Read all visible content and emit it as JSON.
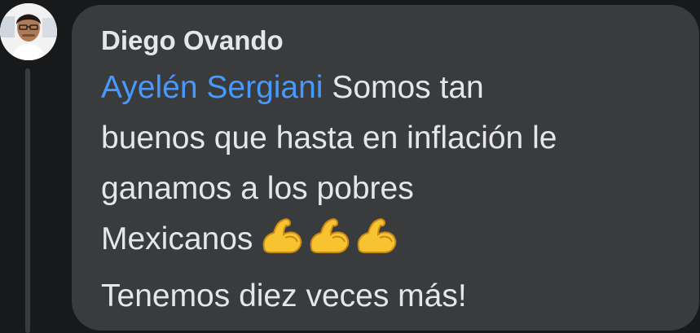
{
  "comment": {
    "author": "Diego Ovando",
    "mention": "Ayelén Sergiani",
    "lines": [
      " Somos tan",
      "buenos que hasta en inflación le",
      "ganamos a los pobres",
      "Mexicanos",
      "Tenemos diez veces más!"
    ],
    "emojis": [
      "flexed-biceps-icon",
      "flexed-biceps-icon",
      "flexed-biceps-icon"
    ]
  },
  "colors": {
    "background": "#18191a",
    "bubble": "#3a3b3c",
    "text": "#e4e6eb",
    "mention": "#4599ff",
    "emoji": "#f7c331"
  }
}
